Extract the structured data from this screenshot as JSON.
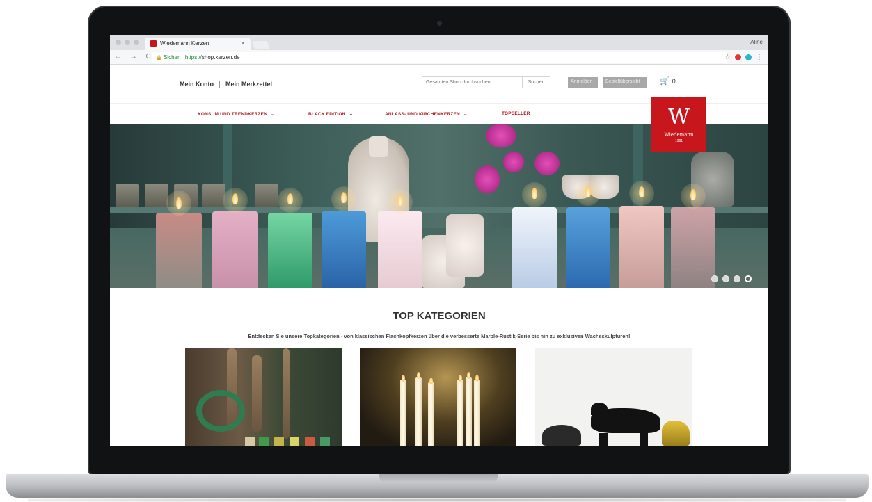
{
  "browser": {
    "tab_title": "Wiedemann Kerzen",
    "tab_close": "×",
    "user": "Aline",
    "nav_buttons": "← → C",
    "url_secure_label": "Sicher",
    "url_protocol": "https://",
    "url_host": "shop.kerzen.de",
    "bookmark_star": "☆",
    "menu_dots": "⋮"
  },
  "header": {
    "account_link": "Mein Konto",
    "wishlist_link": "Mein Merkzettel",
    "search_placeholder": "Gesamten Shop durchsuchen ...",
    "search_button": "Suchen",
    "login_button": "Anmelden",
    "order_overview_button": "Bestellübersicht",
    "cart_icon": "🛒",
    "cart_count": "0"
  },
  "nav": {
    "items": [
      {
        "label": "KONSUM UND TRENDKERZEN",
        "chevron": "⌄"
      },
      {
        "label": "BLACK EDITION",
        "chevron": "⌄"
      },
      {
        "label": "ANLASS- UND KIRCHENKERZEN",
        "chevron": "⌄"
      },
      {
        "label": "TOPSELLER",
        "chevron": ""
      }
    ]
  },
  "logo": {
    "letter": "W",
    "name": "Wiedemann",
    "year": "1961",
    "color": "#c8161d"
  },
  "hero": {
    "slides_total": 4,
    "active_slide": 4
  },
  "categories": {
    "title": "TOP KATEGORIEN",
    "subtitle": "Entdecken Sie unsere Topkategorien - von klassischen Flachkopfkerzen über die verbesserte Marble-Rustik-Serie bis hin zu exklusiven Wachsskulpturen!"
  },
  "colors": {
    "brand_red": "#c8161d",
    "nav_red": "#b0131a",
    "secure_green": "#1a8a3a"
  }
}
